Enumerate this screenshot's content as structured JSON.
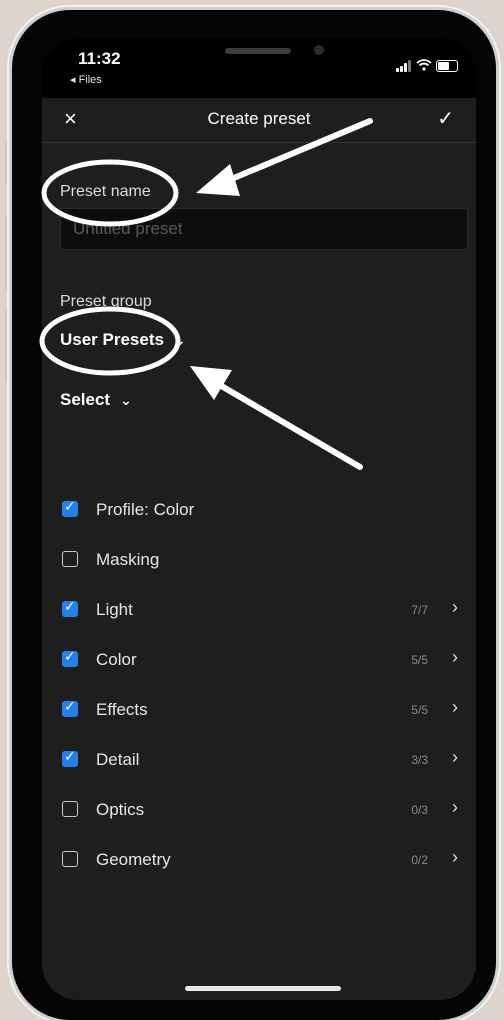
{
  "status_bar": {
    "time": "11:32",
    "back_app": "◂ Files",
    "icons": [
      "signal-icon",
      "wifi-icon",
      "battery-icon"
    ]
  },
  "nav": {
    "close_icon": "×",
    "title": "Create preset",
    "confirm_icon": "✓"
  },
  "preset_name": {
    "label": "Preset name",
    "placeholder": "Untitled preset",
    "value": ""
  },
  "preset_group": {
    "label": "Preset group",
    "selected": "User Presets"
  },
  "select_dropdown": {
    "label": "Select"
  },
  "options": [
    {
      "label": "Profile: Color",
      "checked": true,
      "count": "",
      "has_arrow": false
    },
    {
      "label": "Masking",
      "checked": false,
      "count": "",
      "has_arrow": false
    },
    {
      "label": "Light",
      "checked": true,
      "count": "7/7",
      "has_arrow": true
    },
    {
      "label": "Color",
      "checked": true,
      "count": "5/5",
      "has_arrow": true
    },
    {
      "label": "Effects",
      "checked": true,
      "count": "5/5",
      "has_arrow": true
    },
    {
      "label": "Detail",
      "checked": true,
      "count": "3/3",
      "has_arrow": true
    },
    {
      "label": "Optics",
      "checked": false,
      "count": "0/3",
      "has_arrow": true
    },
    {
      "label": "Geometry",
      "checked": false,
      "count": "0/2",
      "has_arrow": true
    }
  ],
  "colors": {
    "background": "#ddd5cb",
    "screen": "#1e1e1e",
    "checkbox_accent": "#2680eb",
    "annotation": "#ffffff"
  }
}
